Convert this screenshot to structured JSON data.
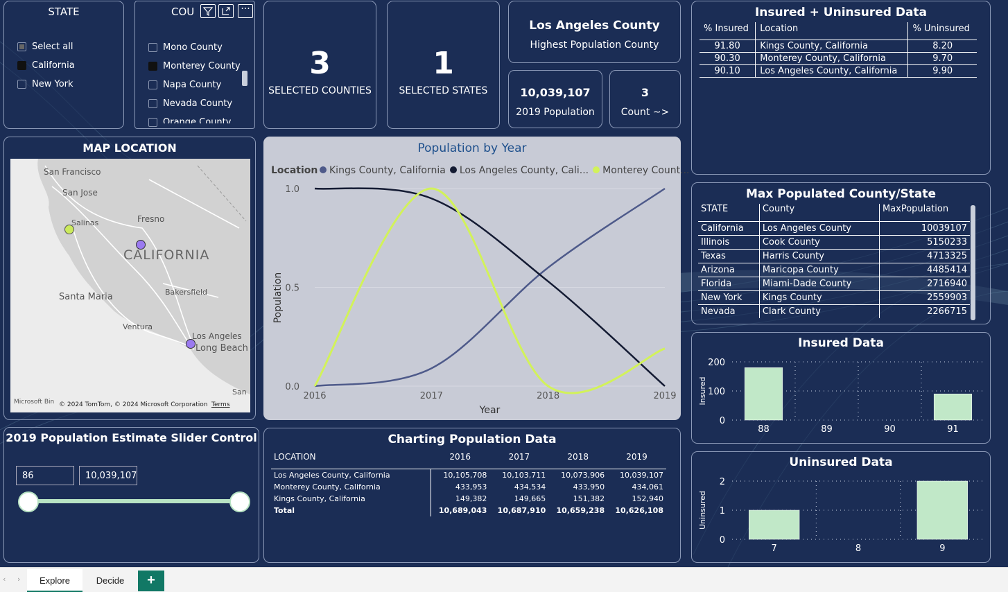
{
  "state_slicer": {
    "title": "STATE",
    "items": [
      {
        "label": "Select all",
        "state": "partial"
      },
      {
        "label": "California",
        "state": "checked"
      },
      {
        "label": "New York",
        "state": "unchecked"
      }
    ]
  },
  "county_slicer": {
    "title": "COU",
    "items": [
      {
        "label": "Mono County",
        "state": "unchecked"
      },
      {
        "label": "Monterey County",
        "state": "checked"
      },
      {
        "label": "Napa County",
        "state": "unchecked"
      },
      {
        "label": "Nevada County",
        "state": "unchecked"
      },
      {
        "label": "Orange County",
        "state": "unchecked"
      }
    ],
    "toolbar": {
      "filter_icon": "filter-icon",
      "focus_icon": "focus-mode-icon",
      "more_icon": "more-options-icon"
    }
  },
  "kpis": {
    "selected_counties": {
      "value": "3",
      "label": "SELECTED COUNTIES"
    },
    "selected_states": {
      "value": "1",
      "label": "SELECTED STATES"
    },
    "highest_county": {
      "value": "Los Angeles County",
      "label": "Highest Population County"
    },
    "population_2019": {
      "value": "10,039,107",
      "label": "2019 Population"
    },
    "count": {
      "value": "3",
      "label": "Count ~>"
    }
  },
  "insured_table": {
    "title": "Insured + Uninsured Data",
    "headers": [
      "% Insured",
      "Location",
      "% Uninsured"
    ],
    "rows": [
      [
        "91.80",
        "Kings County, California",
        "8.20"
      ],
      [
        "90.30",
        "Monterey County, California",
        "9.70"
      ],
      [
        "90.10",
        "Los Angeles County, California",
        "9.90"
      ]
    ]
  },
  "map": {
    "title": "MAP LOCATION",
    "labels": [
      "San Francisco",
      "San Jose",
      "Fresno",
      "Salinas",
      "CALIFORNIA",
      "Santa Maria",
      "Bakersfield",
      "Ventura",
      "Los Angeles",
      "Long Beach",
      "San"
    ],
    "attribution": "© 2024 TomTom, © 2024 Microsoft Corporation",
    "terms": "Terms",
    "brand": "Microsoft Bin",
    "points": [
      {
        "name": "Monterey County",
        "color": "#cbea5c"
      },
      {
        "name": "Kings County",
        "color": "#9b7af0"
      },
      {
        "name": "Los Angeles County",
        "color": "#9b7af0"
      }
    ]
  },
  "line_chart": {
    "title": "Population by Year",
    "legend_title": "Location",
    "legend": [
      {
        "name": "Kings County, California",
        "color": "#4e5a8a"
      },
      {
        "name": "Los Angeles County, Cali...",
        "color": "#141b33"
      },
      {
        "name": "Monterey Count...",
        "color": "#d2f25a"
      }
    ],
    "xlabel": "Year",
    "ylabel": "Population",
    "yticks": [
      "1.0",
      "0.5",
      "0.0"
    ],
    "xticks": [
      "2016",
      "2017",
      "2018",
      "2019"
    ]
  },
  "max_table": {
    "title": "Max Populated County/State",
    "headers": [
      "STATE",
      "County",
      "MaxPopulation"
    ],
    "rows": [
      [
        "California",
        "Los Angeles County",
        "10039107"
      ],
      [
        "Illinois",
        "Cook County",
        "5150233"
      ],
      [
        "Texas",
        "Harris County",
        "4713325"
      ],
      [
        "Arizona",
        "Maricopa County",
        "4485414"
      ],
      [
        "Florida",
        "Miami-Dade County",
        "2716940"
      ],
      [
        "New York",
        "Kings County",
        "2559903"
      ],
      [
        "Nevada",
        "Clark County",
        "2266715"
      ]
    ]
  },
  "insured_chart": {
    "title": "Insured Data",
    "ylabel": "Insured",
    "yticks": [
      "200",
      "100",
      "0"
    ],
    "xticks": [
      "88",
      "89",
      "90",
      "91"
    ]
  },
  "uninsured_chart": {
    "title": "Uninsured Data",
    "ylabel": "Uninsured",
    "yticks": [
      "2",
      "1",
      "0"
    ],
    "xticks": [
      "7",
      "8",
      "9"
    ]
  },
  "slider": {
    "title": "2019 Population Estimate Slider Control",
    "min_value": "86",
    "max_value": "10,039,107"
  },
  "pop_table": {
    "title": "Charting Population Data",
    "headers": [
      "LOCATION",
      "2016",
      "2017",
      "2018",
      "2019"
    ],
    "rows": [
      [
        "Los Angeles County, California",
        "10,105,708",
        "10,103,711",
        "10,073,906",
        "10,039,107"
      ],
      [
        "Monterey County, California",
        "433,953",
        "434,534",
        "433,950",
        "434,061"
      ],
      [
        "Kings County, California",
        "149,382",
        "149,665",
        "151,382",
        "152,940"
      ]
    ],
    "total": [
      "Total",
      "10,689,043",
      "10,687,910",
      "10,659,238",
      "10,626,108"
    ]
  },
  "tabs": {
    "explore": "Explore",
    "decide": "Decide",
    "add": "+"
  },
  "chart_data": [
    {
      "type": "line",
      "title": "Population by Year",
      "x": [
        2016,
        2017,
        2018,
        2019
      ],
      "xlabel": "Year",
      "ylabel": "Population",
      "ylim": [
        0,
        1
      ],
      "series": [
        {
          "name": "Kings County, California",
          "values": [
            0.0,
            0.09,
            0.6,
            1.0
          ]
        },
        {
          "name": "Los Angeles County, Cali...",
          "values": [
            1.0,
            0.95,
            0.53,
            0.0
          ]
        },
        {
          "name": "Monterey Count...",
          "values": [
            0.0,
            1.0,
            0.0,
            0.19
          ]
        }
      ],
      "legend": "top-left"
    },
    {
      "type": "bar",
      "title": "Insured Data",
      "categories": [
        "88",
        "89",
        "90",
        "91"
      ],
      "values": [
        180,
        0,
        0,
        90
      ],
      "ylabel": "Insured",
      "ylim": [
        0,
        200
      ],
      "grid": true
    },
    {
      "type": "bar",
      "title": "Uninsured Data",
      "categories": [
        "7",
        "8",
        "9"
      ],
      "values": [
        1,
        0,
        2
      ],
      "ylabel": "Uninsured",
      "ylim": [
        0,
        2
      ],
      "grid": true
    }
  ]
}
